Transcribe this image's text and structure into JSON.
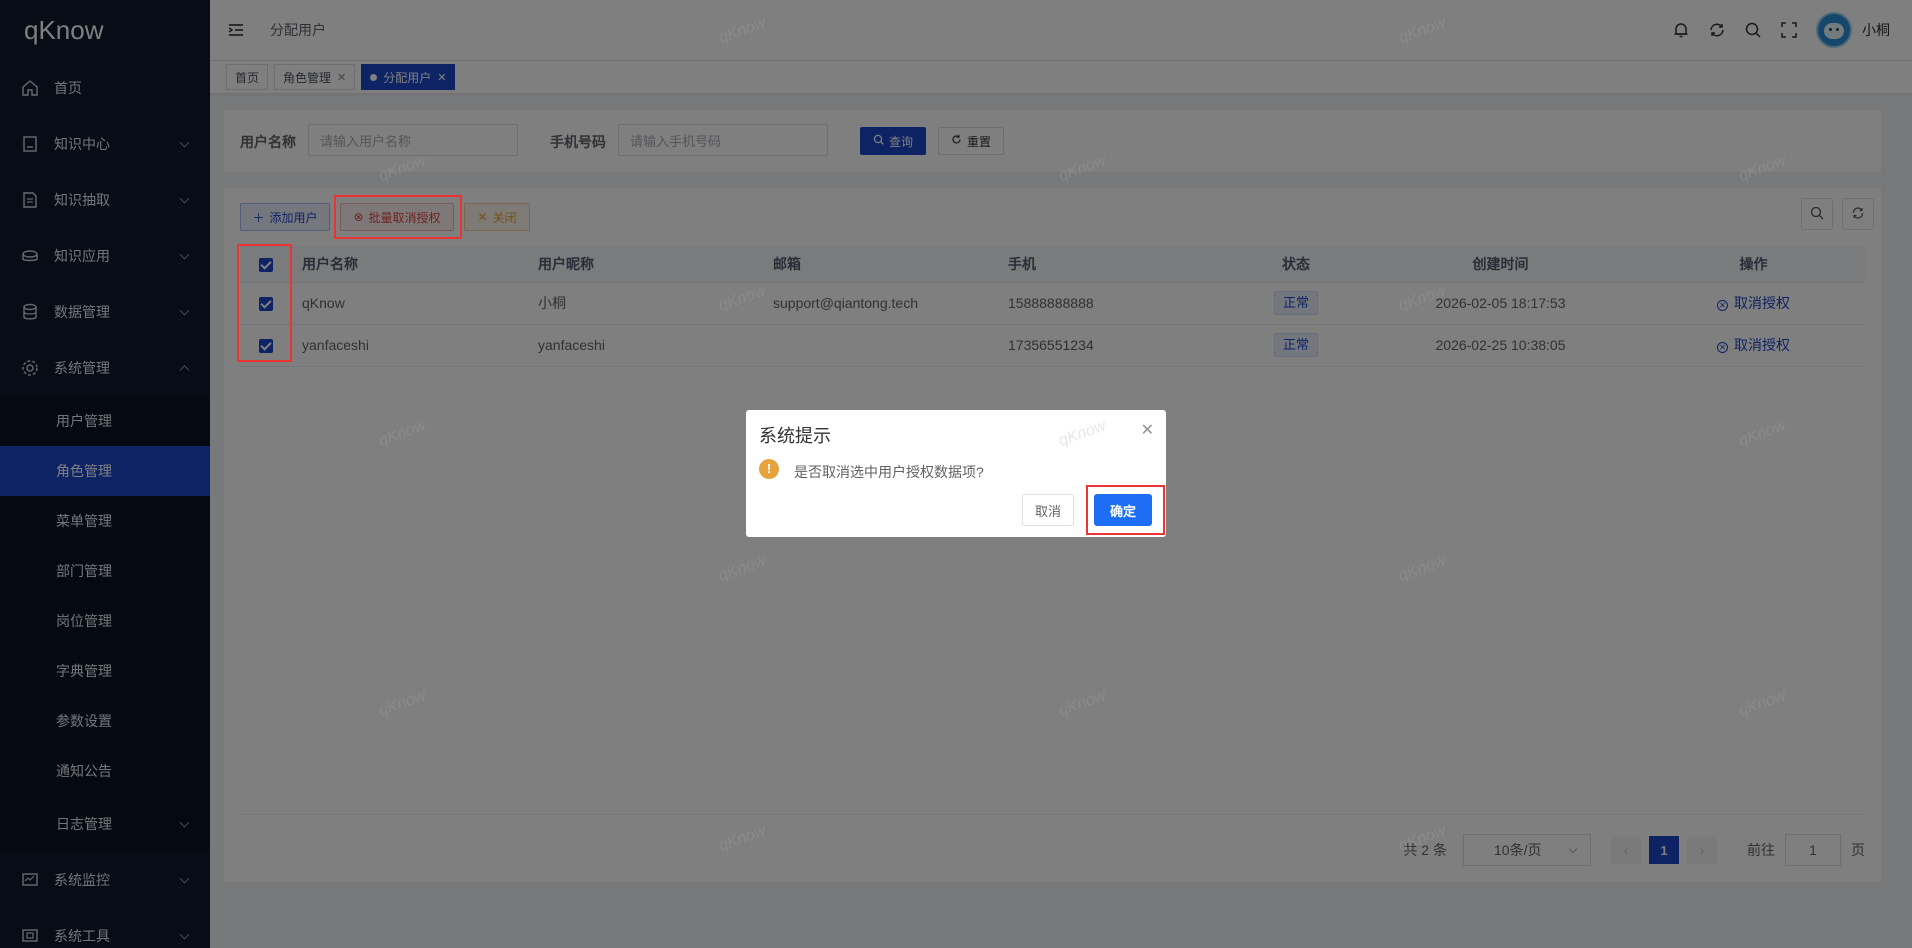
{
  "app": {
    "logo_text": "qKnow"
  },
  "sidebar": {
    "items": [
      {
        "label": "首页",
        "icon": "home-icon"
      },
      {
        "label": "知识中心",
        "icon": "book-icon"
      },
      {
        "label": "知识抽取",
        "icon": "document-icon"
      },
      {
        "label": "知识应用",
        "icon": "app-icon"
      },
      {
        "label": "数据管理",
        "icon": "database-icon"
      },
      {
        "label": "系统管理",
        "icon": "gear-icon"
      }
    ],
    "sub_items": [
      "用户管理",
      "角色管理",
      "菜单管理",
      "部门管理",
      "岗位管理",
      "字典管理",
      "参数设置",
      "通知公告",
      "日志管理"
    ],
    "bottom_items": [
      {
        "label": "系统监控",
        "icon": "monitor-icon"
      },
      {
        "label": "系统工具",
        "icon": "tool-icon"
      }
    ]
  },
  "header": {
    "title": "分配用户",
    "username": "小桐"
  },
  "tags": [
    {
      "label": "首页"
    },
    {
      "label": "角色管理"
    },
    {
      "label": "分配用户"
    }
  ],
  "search": {
    "username_label": "用户名称",
    "username_placeholder": "请输入用户名称",
    "phone_label": "手机号码",
    "phone_placeholder": "请输入手机号码",
    "query_label": "查询",
    "reset_label": "重置"
  },
  "toolbar": {
    "add_label": "添加用户",
    "batch_revoke_label": "批量取消授权",
    "close_label": "关闭"
  },
  "table": {
    "columns": [
      "用户名称",
      "用户昵称",
      "邮箱",
      "手机",
      "状态",
      "创建时间",
      "操作"
    ],
    "rows": [
      {
        "username": "qKnow",
        "nickname": "小桐",
        "email": "support@qiantong.tech",
        "phone": "15888888888",
        "status": "正常",
        "created": "2026-02-05 18:17:53",
        "action": "取消授权"
      },
      {
        "username": "yanfaceshi",
        "nickname": "yanfaceshi",
        "email": "",
        "phone": "17356551234",
        "status": "正常",
        "created": "2026-02-25 10:38:05",
        "action": "取消授权"
      }
    ]
  },
  "pagination": {
    "total": "共 2 条",
    "page_size": "10条/页",
    "current_page": "1",
    "goto_label": "前往",
    "goto_value": "1",
    "page_suffix": "页"
  },
  "dialog": {
    "title": "系统提示",
    "message": "是否取消选中用户授权数据项?",
    "cancel_label": "取消",
    "confirm_label": "确定"
  },
  "watermark": "qKnow",
  "colors": {
    "primary": "#1d47c9",
    "sidebar_bg": "#0f1b2d",
    "warning": "#e6a23c",
    "danger": "#e04545",
    "highlight": "#ee3333"
  }
}
